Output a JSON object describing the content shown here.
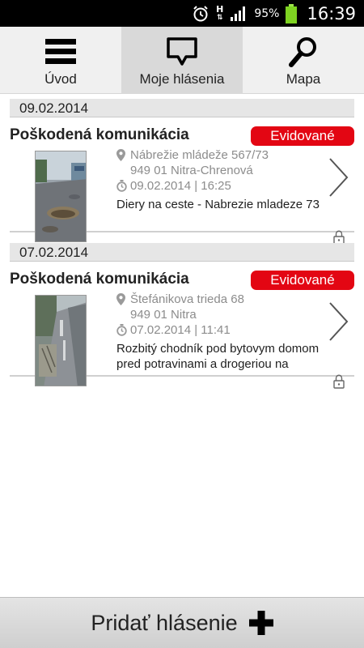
{
  "status_bar": {
    "network_label": "H",
    "battery_percent": "95%",
    "time": "16:39",
    "icons": [
      "alarm-icon",
      "network-h-icon",
      "signal-icon",
      "battery-icon"
    ]
  },
  "nav": {
    "tabs": [
      {
        "label": "Úvod",
        "icon": "menu-icon",
        "active": false
      },
      {
        "label": "Moje hlásenia",
        "icon": "speech-bubble-icon",
        "active": true
      },
      {
        "label": "Mapa",
        "icon": "search-icon",
        "active": false
      }
    ]
  },
  "reports": [
    {
      "date_header": "09.02.2014",
      "title": "Poškodená komunikácia",
      "status": "Evidované",
      "address_line1": "Nábrežie mládeže 567/73",
      "address_line2": "949 01 Nitra-Chrenová",
      "datetime": "09.02.2014 | 16:25",
      "description": "Diery na ceste - Nabrezie mladeze 73",
      "image": "pothole-road-photo"
    },
    {
      "date_header": "07.02.2014",
      "title": "Poškodená komunikácia",
      "status": "Evidované",
      "address_line1": "Štefánikova trieda 68",
      "address_line2": "949 01 Nitra",
      "datetime": "07.02.2014 | 11:41",
      "description": "Rozbitý chodník pod bytovym domom pred potravinami a drogeriou na",
      "image": "broken-sidewalk-photo"
    }
  ],
  "bottom": {
    "add_label": "Pridať hlásenie"
  },
  "colors": {
    "status_badge": "#e30613",
    "nav_background": "#f0f0f0",
    "nav_active": "#d9d9d9",
    "date_header_bg": "#e6e6e6",
    "secondary_text": "#8c8c8c"
  }
}
